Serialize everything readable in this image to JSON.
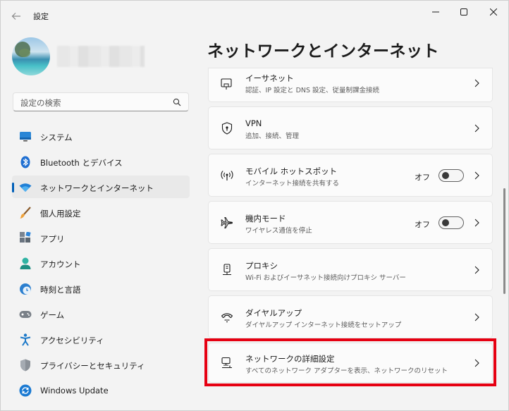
{
  "window": {
    "title": "設定"
  },
  "search": {
    "placeholder": "設定の検索"
  },
  "sidebar": {
    "items": [
      {
        "label": "システム",
        "icon": "monitor-icon",
        "active": false
      },
      {
        "label": "Bluetooth とデバイス",
        "icon": "bluetooth-icon",
        "active": false
      },
      {
        "label": "ネットワークとインターネット",
        "icon": "wifi-icon",
        "active": true
      },
      {
        "label": "個人用設定",
        "icon": "brush-icon",
        "active": false
      },
      {
        "label": "アプリ",
        "icon": "apps-icon",
        "active": false
      },
      {
        "label": "アカウント",
        "icon": "person-icon",
        "active": false
      },
      {
        "label": "時刻と言語",
        "icon": "clock-globe-icon",
        "active": false
      },
      {
        "label": "ゲーム",
        "icon": "gamepad-icon",
        "active": false
      },
      {
        "label": "アクセシビリティ",
        "icon": "accessibility-icon",
        "active": false
      },
      {
        "label": "プライバシーとセキュリティ",
        "icon": "shield-icon",
        "active": false
      },
      {
        "label": "Windows Update",
        "icon": "update-icon",
        "active": false
      }
    ]
  },
  "main": {
    "title": "ネットワークとインターネット",
    "cards": [
      {
        "title": "イーサネット",
        "subtitle": "認証、IP 設定と DNS 設定、従量制課金接続",
        "icon": "ethernet-icon"
      },
      {
        "title": "VPN",
        "subtitle": "追加、接続、管理",
        "icon": "vpn-shield-icon"
      },
      {
        "title": "モバイル ホットスポット",
        "subtitle": "インターネット接続を共有する",
        "icon": "hotspot-icon",
        "toggle_label": "オフ",
        "toggle_on": false
      },
      {
        "title": "機内モード",
        "subtitle": "ワイヤレス通信を停止",
        "icon": "airplane-icon",
        "toggle_label": "オフ",
        "toggle_on": false
      },
      {
        "title": "プロキシ",
        "subtitle": "Wi-Fi およびイーサネット接続向けプロキシ サーバー",
        "icon": "proxy-icon"
      },
      {
        "title": "ダイヤルアップ",
        "subtitle": "ダイヤルアップ インターネット接続をセットアップ",
        "icon": "dialup-icon"
      },
      {
        "title": "ネットワークの詳細設定",
        "subtitle": "すべてのネットワーク アダプターを表示、ネットワークのリセット",
        "icon": "network-pc-icon"
      }
    ]
  },
  "colors": {
    "accent": "#005fb8",
    "highlight": "#e60012"
  }
}
